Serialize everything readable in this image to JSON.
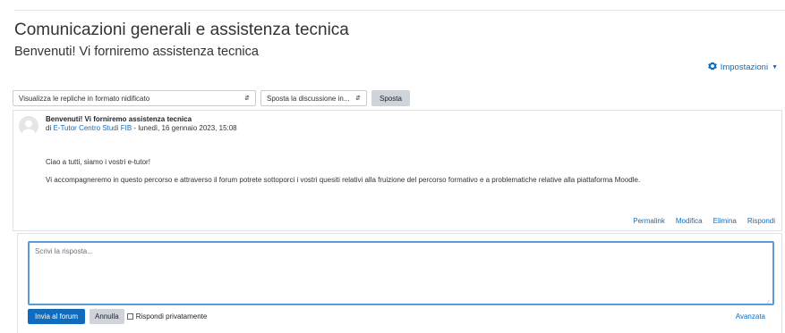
{
  "header": {
    "page_title": "Comunicazioni generali e assistenza tecnica",
    "discussion_title": "Benvenuti! Vi forniremo assistenza tecnica",
    "settings_label": "Impostazioni"
  },
  "controls": {
    "display_mode": "Visualizza le repliche in formato nidificato",
    "move_discussion": "Sposta la discussione in...",
    "move_button": "Sposta"
  },
  "post": {
    "subject": "Benvenuti! Vi forniremo assistenza tecnica",
    "by_prefix": "di",
    "author": "E-Tutor Centro Studi FIB",
    "date": " - lunedì, 16 gennaio 2023, 15:08",
    "paragraphs": [
      "Ciao a tutti, siamo i vostri e-tutor!",
      "Vi accompagneremo in questo percorso e attraverso il forum potrete sottoporci i vostri quesiti relativi alla fruizione del percorso formativo e a problematiche relative alla piattaforma Moodle."
    ],
    "actions": {
      "permalink": "Permalink",
      "edit": "Modifica",
      "delete": "Elimina",
      "reply": "Rispondi"
    }
  },
  "reply": {
    "placeholder": "Scrivi la risposta...",
    "submit": "Invia al forum",
    "cancel": "Annulla",
    "private_label": "Rispondi privatamente",
    "advanced": "Avanzata"
  },
  "colors": {
    "accent": "#0f6cbf",
    "focus_border": "#5b9bd5",
    "secondary_button": "#ced4da"
  },
  "icons": {
    "settings": "gear-icon",
    "settings_caret": "caret-down-icon",
    "select_arrow": "updown-arrow-icon",
    "avatar": "user-avatar-icon"
  }
}
